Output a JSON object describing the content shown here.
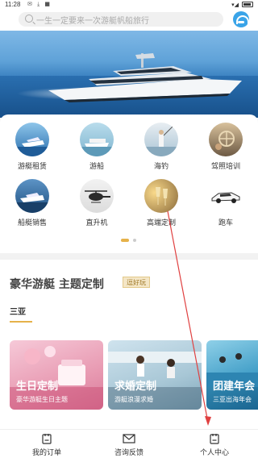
{
  "status": {
    "time": "11:28",
    "icons": "✉ ⤓ ■"
  },
  "search": {
    "placeholder": "一生一定要来一次游艇帆船旅行"
  },
  "grid": {
    "items": [
      {
        "label": "游艇租赁",
        "icon": "yacht-rental-icon"
      },
      {
        "label": "游船",
        "icon": "cruise-ship-icon"
      },
      {
        "label": "海钓",
        "icon": "sea-fishing-icon"
      },
      {
        "label": "驾照培训",
        "icon": "license-training-icon"
      },
      {
        "label": "船艇销售",
        "icon": "boat-sales-icon"
      },
      {
        "label": "直升机",
        "icon": "helicopter-icon"
      },
      {
        "label": "高端定制",
        "icon": "premium-custom-icon"
      },
      {
        "label": "跑车",
        "icon": "sports-car-icon"
      }
    ]
  },
  "section": {
    "title": "豪华游艇 主题定制",
    "tag": "逗好玩",
    "subtitle": "三亚",
    "cards": [
      {
        "title": "生日定制",
        "desc": "豪华游艇生日主题"
      },
      {
        "title": "求婚定制",
        "desc": "游艇浪漫求婚"
      },
      {
        "title": "团建年会",
        "desc": "三亚出海年会"
      }
    ]
  },
  "tabbar": {
    "tabs": [
      {
        "label": "我的订单",
        "icon": "order-icon"
      },
      {
        "label": "咨询反馈",
        "icon": "mail-icon"
      },
      {
        "label": "个人中心",
        "icon": "profile-icon"
      }
    ]
  },
  "colors": {
    "accent": "#e6b24a",
    "tag_bg": "#f4e6c6",
    "annotation_arrow": "#e04040"
  }
}
